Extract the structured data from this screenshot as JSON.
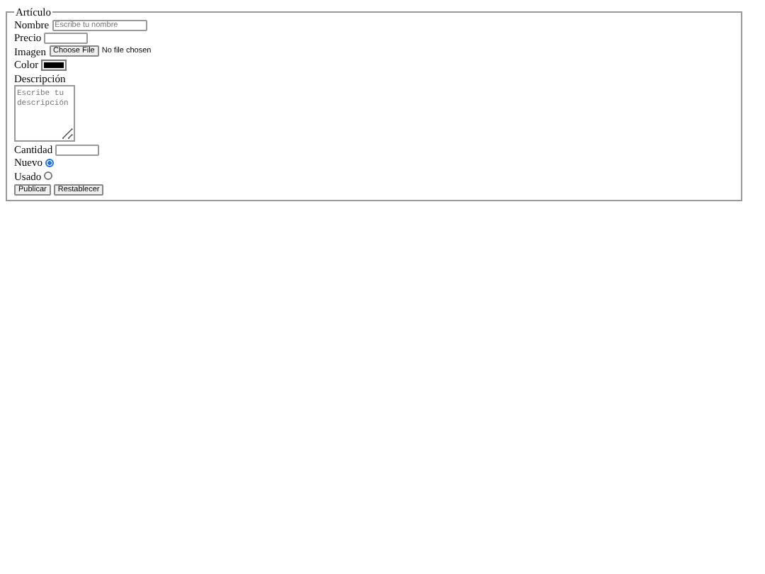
{
  "fieldset": {
    "legend": "Artículo",
    "fields": [
      {
        "kind": "text",
        "label": "Nombre",
        "placeholder": "Escribe tu nombre"
      },
      {
        "kind": "text",
        "label": "Precio"
      },
      {
        "kind": "file",
        "label": "Imagen",
        "button": "Choose File",
        "status": "No file chosen"
      },
      {
        "kind": "color",
        "label": "Color",
        "color": "#000000"
      },
      {
        "kind": "textarea",
        "label": "Descripción",
        "placeholder": "Escribe tu descripción"
      },
      {
        "kind": "text",
        "label": "Cantidad"
      },
      {
        "kind": "radio",
        "label": "Nuevo",
        "selected": true
      },
      {
        "kind": "radio",
        "label": "Usado",
        "selected": false
      }
    ],
    "buttons": [
      "Publicar",
      "Restablecer"
    ]
  }
}
